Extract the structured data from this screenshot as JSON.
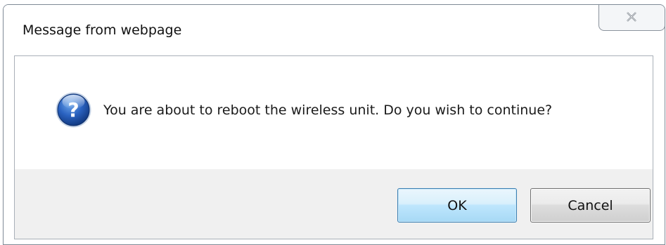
{
  "dialog": {
    "title": "Message from webpage",
    "message": "You are about to reboot the wireless unit. Do you wish to continue?",
    "icon": "question-icon",
    "buttons": {
      "ok_label": "OK",
      "cancel_label": "Cancel"
    },
    "close_icon": "close-icon"
  },
  "colors": {
    "ok_button_border": "#3c7fb1",
    "button_bar_background": "#f0f0f0",
    "icon_blue": "#1f4fa0"
  }
}
